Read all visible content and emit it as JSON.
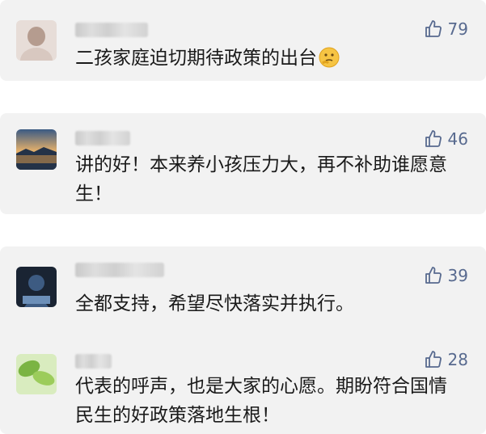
{
  "comments": [
    {
      "text": "二孩家庭迫切期待政策的出台",
      "likes": "79",
      "emoji": "thinking-face-icon"
    },
    {
      "text": "讲的好！本来养小孩压力大，再不补助谁愿意生！",
      "likes": "46"
    },
    {
      "text": "全都支持，希望尽快落实并执行。",
      "likes": "39"
    },
    {
      "text": "代表的呼声，也是大家的心愿。期盼符合国情民生的好政策落地生根！",
      "likes": "28"
    }
  ],
  "colors": {
    "card_bg": "#f2f2f2",
    "like_blue": "#586a8f",
    "text": "#1a1a1a"
  }
}
